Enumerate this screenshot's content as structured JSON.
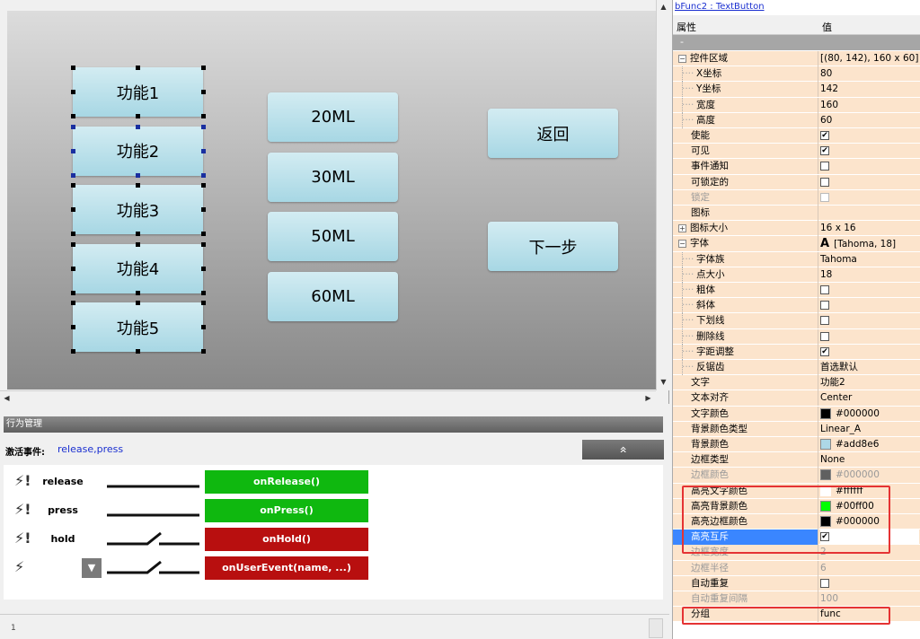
{
  "canvas": {
    "left_buttons": [
      "功能1",
      "功能2",
      "功能3",
      "功能4",
      "功能5"
    ],
    "mid_buttons": [
      "20ML",
      "30ML",
      "50ML",
      "60ML"
    ],
    "right_buttons": [
      "返回",
      "下一步"
    ]
  },
  "behavior": {
    "title": "行为管理",
    "active_label": "激活事件:",
    "active_value": "release,press",
    "collapse_icon": "«",
    "events": [
      {
        "icon": "⚡!",
        "name": "release",
        "handler": "onRelease()",
        "color": "green"
      },
      {
        "icon": "⚡!",
        "name": "press",
        "handler": "onPress()",
        "color": "green"
      },
      {
        "icon": "⚡!",
        "name": "hold",
        "handler": "onHold()",
        "color": "red"
      },
      {
        "icon": "⚡",
        "name": "",
        "handler": "onUserEvent(name, ...)",
        "color": "red"
      }
    ],
    "line_number": "1"
  },
  "props": {
    "title": "bFunc2 : TextButton",
    "col_name": "属性",
    "col_value": "值",
    "category": "-",
    "rows": [
      {
        "name": "控件区域",
        "value": "[(80, 142), 160 x 60]",
        "exp": "⊟"
      },
      {
        "name": "X坐标",
        "value": "80",
        "sub": true
      },
      {
        "name": "Y坐标",
        "value": "142",
        "sub": true
      },
      {
        "name": "宽度",
        "value": "160",
        "sub": true
      },
      {
        "name": "高度",
        "value": "60",
        "sub": true
      },
      {
        "name": "使能",
        "value": "",
        "cb": "✔"
      },
      {
        "name": "可见",
        "value": "",
        "cb": "✔"
      },
      {
        "name": "事件通知",
        "value": "",
        "cb": ""
      },
      {
        "name": "可锁定的",
        "value": "",
        "cb": ""
      },
      {
        "name": "锁定",
        "value": "",
        "cb": "",
        "gray": true
      },
      {
        "name": "图标",
        "value": ""
      },
      {
        "name": "图标大小",
        "value": "16 x 16",
        "exp": "⊞"
      },
      {
        "name": "字体",
        "value": "[Tahoma, 18]",
        "exp": "⊟",
        "fonticon": "A"
      },
      {
        "name": "字体族",
        "value": "Tahoma",
        "sub": true
      },
      {
        "name": "点大小",
        "value": "18",
        "sub": true
      },
      {
        "name": "粗体",
        "value": "",
        "cb": "",
        "sub": true
      },
      {
        "name": "斜体",
        "value": "",
        "cb": "",
        "sub": true
      },
      {
        "name": "下划线",
        "value": "",
        "cb": "",
        "sub": true
      },
      {
        "name": "删除线",
        "value": "",
        "cb": "",
        "sub": true
      },
      {
        "name": "字距调整",
        "value": "",
        "cb": "✔",
        "sub": true
      },
      {
        "name": "反锯齿",
        "value": "首选默认",
        "sub": true
      },
      {
        "name": "文字",
        "value": "功能2"
      },
      {
        "name": "文本对齐",
        "value": "Center"
      },
      {
        "name": "文字颜色",
        "value": "#000000",
        "swatch": "#000000"
      },
      {
        "name": "背景颜色类型",
        "value": "Linear_A"
      },
      {
        "name": "背景颜色",
        "value": "#add8e6",
        "swatch": "#add8e6"
      },
      {
        "name": "边框类型",
        "value": "None"
      },
      {
        "name": "边框颜色",
        "value": "#000000",
        "swatch": "#606060",
        "gray": true
      },
      {
        "name": "高亮文字颜色",
        "value": "#ffffff",
        "swatch": "#ffffff"
      },
      {
        "name": "高亮背景颜色",
        "value": "#00ff00",
        "swatch": "#00ff00"
      },
      {
        "name": "高亮边框颜色",
        "value": "#000000",
        "swatch": "#000000"
      },
      {
        "name": "高亮互斥",
        "value": "",
        "cb": "✔",
        "selected": true
      },
      {
        "name": "边框宽度",
        "value": "2",
        "gray": true
      },
      {
        "name": "边框半径",
        "value": "6",
        "gray": true
      },
      {
        "name": "自动重复",
        "value": "",
        "cb": ""
      },
      {
        "name": "自动重复间隔",
        "value": "100",
        "gray": true
      },
      {
        "name": "分组",
        "value": "func"
      }
    ]
  }
}
